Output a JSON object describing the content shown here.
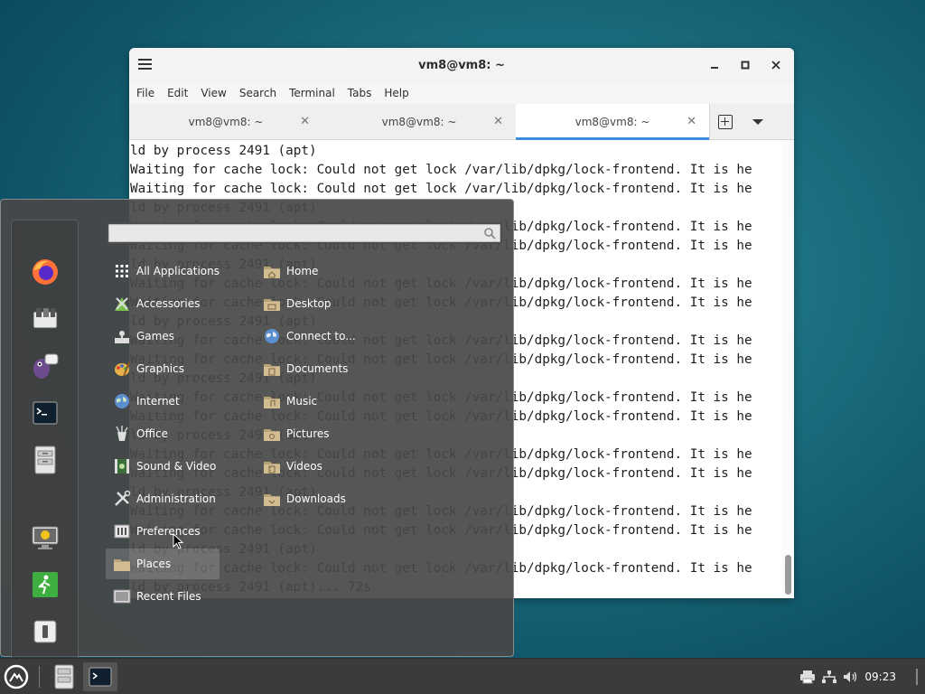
{
  "window": {
    "title": "vm8@vm8: ~",
    "menu": [
      "File",
      "Edit",
      "View",
      "Search",
      "Terminal",
      "Tabs",
      "Help"
    ],
    "tabs": [
      {
        "label": "vm8@vm8: ~"
      },
      {
        "label": "vm8@vm8: ~"
      },
      {
        "label": "vm8@vm8: ~"
      }
    ],
    "terminal_lines": [
      "ld by process 2491 (apt)",
      "Waiting for cache lock: Could not get lock /var/lib/dpkg/lock-frontend. It is he",
      "Waiting for cache lock: Could not get lock /var/lib/dpkg/lock-frontend. It is he",
      "ld by process 2491 (apt)",
      "Waiting for cache lock: Could not get lock /var/lib/dpkg/lock-frontend. It is he",
      "Waiting for cache lock: Could not get lock /var/lib/dpkg/lock-frontend. It is he",
      "ld by process 2491 (apt)",
      "Waiting for cache lock: Could not get lock /var/lib/dpkg/lock-frontend. It is he",
      "Waiting for cache lock: Could not get lock /var/lib/dpkg/lock-frontend. It is he",
      "ld by process 2491 (apt)",
      "Waiting for cache lock: Could not get lock /var/lib/dpkg/lock-frontend. It is he",
      "Waiting for cache lock: Could not get lock /var/lib/dpkg/lock-frontend. It is he",
      "ld by process 2491 (apt)",
      "Waiting for cache lock: Could not get lock /var/lib/dpkg/lock-frontend. It is he",
      "Waiting for cache lock: Could not get lock /var/lib/dpkg/lock-frontend. It is he",
      "ld by process 2491 (apt)",
      "Waiting for cache lock: Could not get lock /var/lib/dpkg/lock-frontend. It is he",
      "Waiting for cache lock: Could not get lock /var/lib/dpkg/lock-frontend. It is he",
      "ld by process 2491 (apt)",
      "Waiting for cache lock: Could not get lock /var/lib/dpkg/lock-frontend. It is he",
      "Waiting for cache lock: Could not get lock /var/lib/dpkg/lock-frontend. It is he",
      "ld by process 2491 (apt)",
      "Waiting for cache lock: Could not get lock /var/lib/dpkg/lock-frontend. It is he",
      "ld by process 2491 (apt)... 72s"
    ]
  },
  "appmenu": {
    "search_placeholder": "",
    "favorites": [
      {
        "name": "Firefox",
        "icon": "firefox-icon"
      },
      {
        "name": "Software Manager",
        "icon": "software-manager-icon"
      },
      {
        "name": "Pidgin",
        "icon": "pidgin-icon"
      },
      {
        "name": "Terminal",
        "icon": "terminal-icon"
      },
      {
        "name": "Files",
        "icon": "file-cabinet-icon"
      },
      {
        "name": "Lock Screen",
        "icon": "lock-screen-icon"
      },
      {
        "name": "Logout",
        "icon": "logout-icon"
      },
      {
        "name": "Shutdown",
        "icon": "power-icon"
      }
    ],
    "categories": [
      {
        "label": "All Applications",
        "icon": "grid-icon"
      },
      {
        "label": "Accessories",
        "icon": "accessories-icon"
      },
      {
        "label": "Games",
        "icon": "games-icon"
      },
      {
        "label": "Graphics",
        "icon": "graphics-icon"
      },
      {
        "label": "Internet",
        "icon": "globe-icon"
      },
      {
        "label": "Office",
        "icon": "office-icon"
      },
      {
        "label": "Sound & Video",
        "icon": "sound-video-icon"
      },
      {
        "label": "Administration",
        "icon": "tools-icon"
      },
      {
        "label": "Preferences",
        "icon": "preferences-icon"
      },
      {
        "label": "Places",
        "icon": "folder-icon",
        "selected": true
      },
      {
        "label": "Recent Files",
        "icon": "recent-files-icon"
      }
    ],
    "places": [
      {
        "label": "Home",
        "icon": "home-folder-icon"
      },
      {
        "label": "Desktop",
        "icon": "desktop-folder-icon"
      },
      {
        "label": "Connect to...",
        "icon": "network-globe-icon"
      },
      {
        "label": "Documents",
        "icon": "documents-folder-icon"
      },
      {
        "label": "Music",
        "icon": "music-folder-icon"
      },
      {
        "label": "Pictures",
        "icon": "pictures-folder-icon"
      },
      {
        "label": "Videos",
        "icon": "videos-folder-icon"
      },
      {
        "label": "Downloads",
        "icon": "downloads-folder-icon"
      }
    ]
  },
  "taskbar": {
    "clock": "09:23"
  },
  "colors": {
    "tab_accent": "#3b8de0",
    "menu_bg": "#484848",
    "taskbar_bg": "#3b3b3b"
  }
}
